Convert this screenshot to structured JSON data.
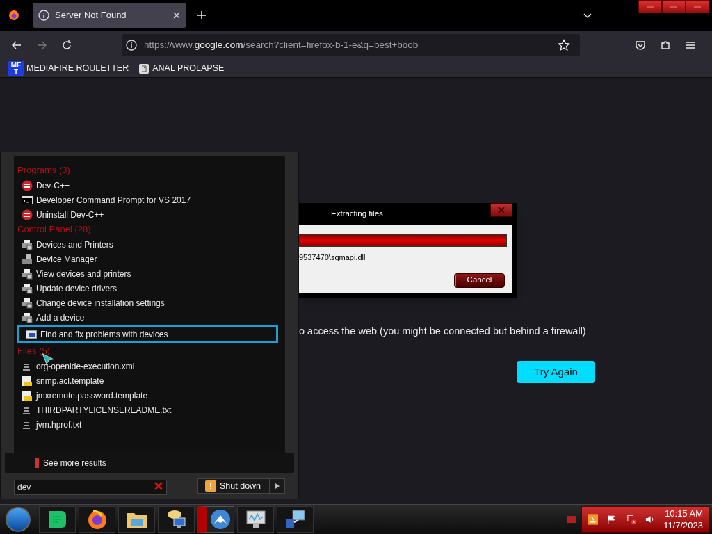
{
  "browser": {
    "tabs": [
      {
        "title": "Server Not Found",
        "selected": true
      }
    ],
    "url": {
      "prefix": "https://www.",
      "host": "google.com",
      "path": "/search?client=firefox-b-1-e&q=best+boob"
    },
    "bookmarks": [
      {
        "label": "MEDIAFIRE ROULETTER",
        "kind": "mft",
        "favicon_lines": [
          "MF",
          "T"
        ]
      },
      {
        "label": "ANAL PROLAPSE",
        "kind": "page"
      }
    ]
  },
  "page": {
    "message": "o access the web (you might be connected but behind a firewall)",
    "button": "Try Again"
  },
  "dialog": {
    "title": "Extracting files",
    "level": 1,
    "file": "9537470\\sqmapi.dll",
    "cancel": "Cancel"
  },
  "start_menu": {
    "groups": [
      {
        "title": "Programs (3)",
        "items": [
          {
            "label": "Dev-C++",
            "kind": "devcpp",
            "selected": false
          },
          {
            "label": "Developer Command Prompt for VS 2017",
            "kind": "cmd",
            "selected": false
          },
          {
            "label": "Uninstall Dev-C++",
            "kind": "devcpp",
            "selected": false
          }
        ]
      },
      {
        "title": "Control Panel (28)",
        "items": [
          {
            "label": "Devices and Printers",
            "kind": "printer",
            "selected": false
          },
          {
            "label": "Device Manager",
            "kind": "manager",
            "selected": false
          },
          {
            "label": "View devices and printers",
            "kind": "printer",
            "selected": false
          },
          {
            "label": "Update device drivers",
            "kind": "printer",
            "selected": false
          },
          {
            "label": "Change device installation settings",
            "kind": "printer",
            "selected": false
          },
          {
            "label": "Add a device",
            "kind": "printer",
            "selected": false
          },
          {
            "label": "Find and fix problems with devices",
            "kind": "troubleshoot",
            "selected": true
          }
        ]
      },
      {
        "title": "Files (5)",
        "items": [
          {
            "label": "org-openide-execution.xml",
            "kind": "textfile",
            "selected": false
          },
          {
            "label": "snmp.acl.template",
            "kind": "template",
            "selected": false
          },
          {
            "label": "jmxremote.password.template",
            "kind": "template",
            "selected": false
          },
          {
            "label": "THIRDPARTYLICENSEREADME.txt",
            "kind": "textfile",
            "selected": false
          },
          {
            "label": "jvm.hprof.txt",
            "kind": "textfile",
            "selected": false
          }
        ]
      }
    ],
    "see_more": "See more results",
    "search": {
      "value": "dev"
    },
    "shutdown": "Shut down"
  },
  "taskbar": {
    "apps": [
      {
        "kind": "chat",
        "active": false
      },
      {
        "kind": "firefox",
        "active": false
      },
      {
        "kind": "folder",
        "active": false
      },
      {
        "kind": "messenger",
        "active": false
      },
      {
        "kind": "vpn",
        "active": true
      },
      {
        "kind": "monitor",
        "active": false
      },
      {
        "kind": "network",
        "active": false
      }
    ],
    "time": "10:15 AM",
    "date": "11/7/2023"
  }
}
